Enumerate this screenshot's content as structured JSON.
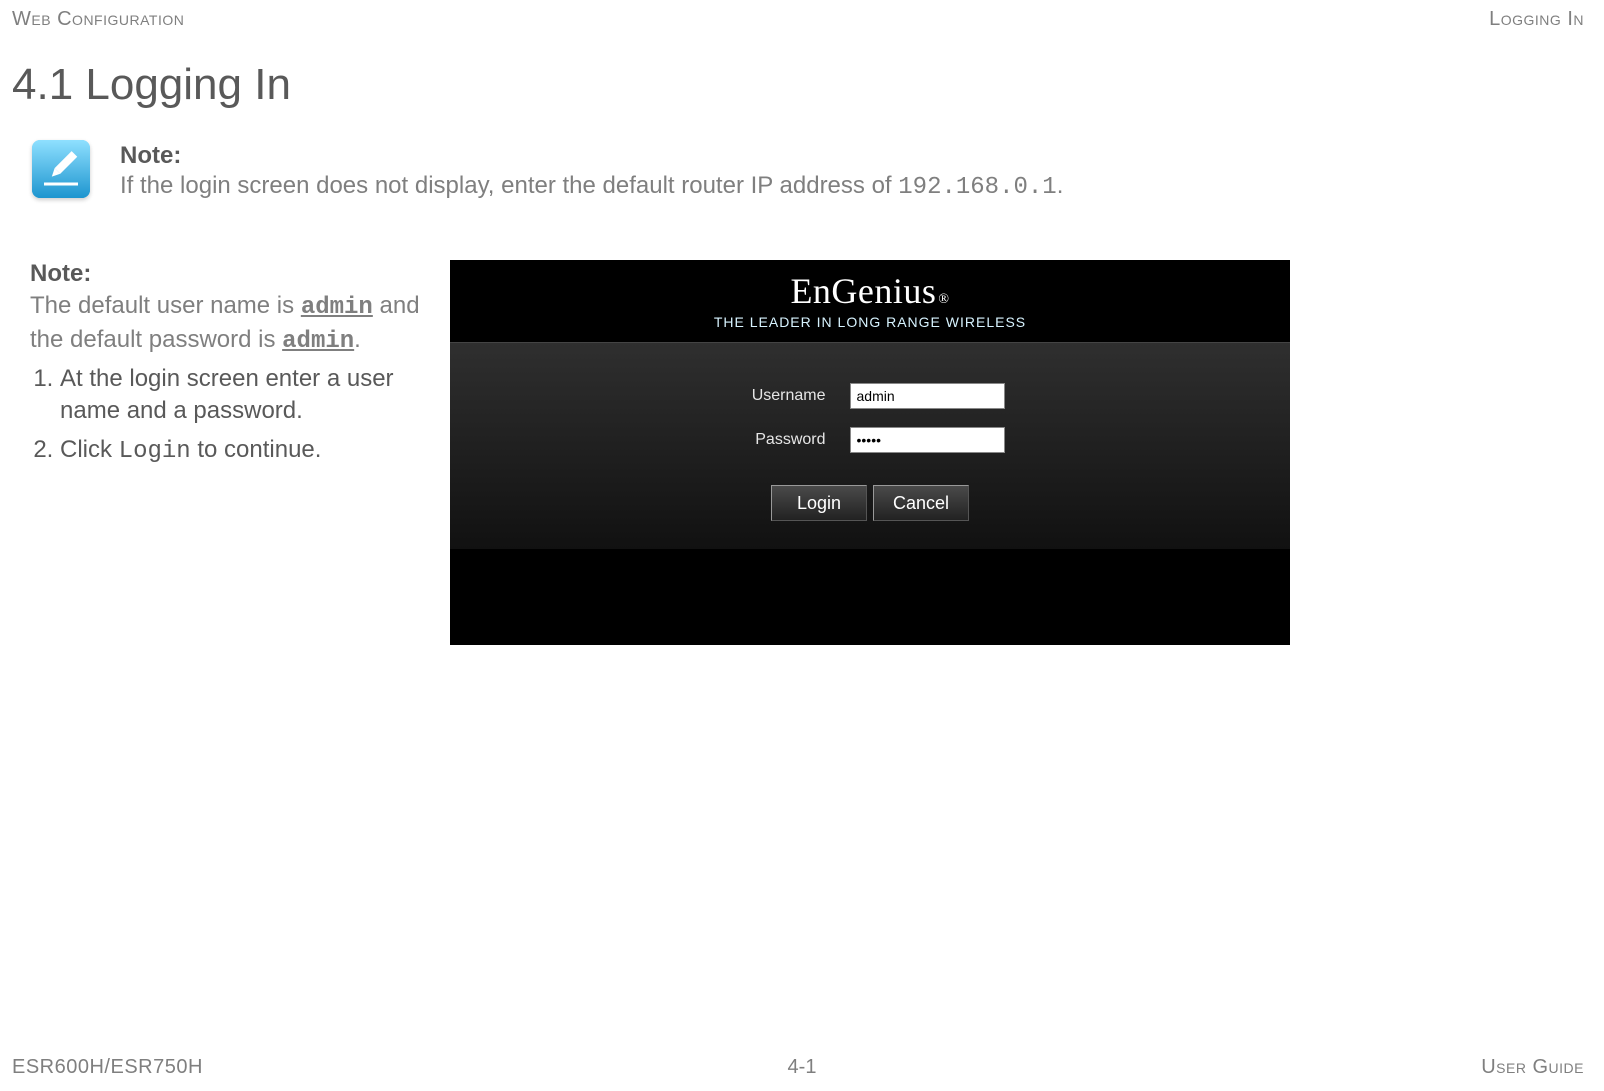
{
  "header": {
    "left": "Web Configuration",
    "right": "Logging In"
  },
  "section_title": "4.1 Logging In",
  "note1": {
    "label": "Note:",
    "body_prefix": "If the login screen does not display, enter the default router IP address of ",
    "ip": "192.168.0.1",
    "body_suffix": "."
  },
  "note2": {
    "label": "Note:",
    "line_a": "The default user name is ",
    "default_user": "admin",
    "line_b": " and the default password is ",
    "default_pass": "admin",
    "line_c": "."
  },
  "steps": {
    "s1": "At the login screen enter a user name and a password.",
    "s2_prefix": "Click ",
    "s2_command": "Login",
    "s2_suffix": " to continue."
  },
  "login_panel": {
    "brand": "EnGenius",
    "reg": "®",
    "tagline": "THE LEADER IN LONG RANGE WIRELESS",
    "username_label": "Username",
    "username_value": "admin",
    "password_label": "Password",
    "password_value": "•••••",
    "login_button": "Login",
    "cancel_button": "Cancel"
  },
  "footer": {
    "left": "ESR600H/ESR750H",
    "center": "4-1",
    "right": "User Guide"
  }
}
